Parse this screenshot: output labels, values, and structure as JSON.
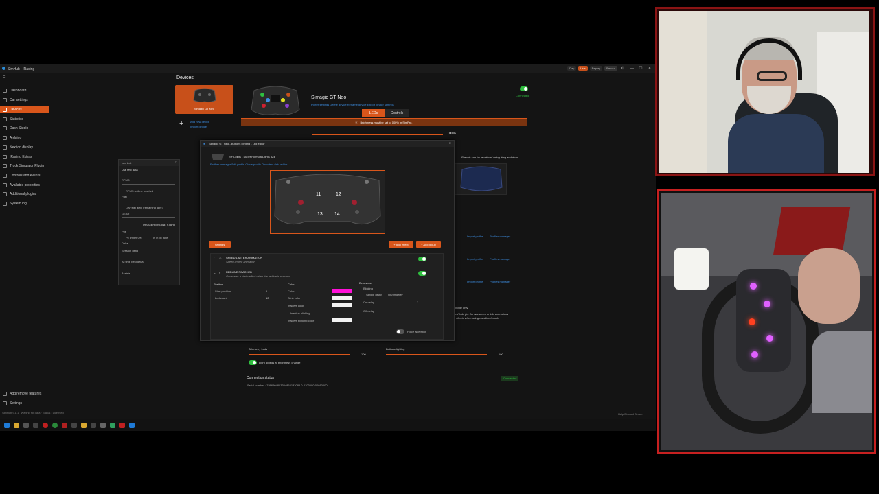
{
  "app": {
    "title": "SimHub - IRacing",
    "top_chips": {
      "day": "Day",
      "live": "Live",
      "replay": "Replay",
      "record": "Record"
    },
    "window_controls": {
      "settings": "⚙",
      "minimize": "—",
      "maximize": "☐",
      "close": "✕"
    }
  },
  "sidebar": {
    "items": [
      {
        "label": "Dashboard"
      },
      {
        "label": "Car settings"
      },
      {
        "label": "Devices",
        "active": true
      },
      {
        "label": "Statistics"
      },
      {
        "label": "Dash Studio"
      },
      {
        "label": "Arduino"
      },
      {
        "label": "Nextion display"
      },
      {
        "label": "IRacing Extras"
      },
      {
        "label": "Truck Simulator Plugin"
      },
      {
        "label": "Controls and events"
      },
      {
        "label": "Available properties"
      },
      {
        "label": "Additional plugins"
      },
      {
        "label": "System log"
      }
    ],
    "bottom": [
      {
        "label": "Add/remove features"
      },
      {
        "label": "Settings"
      }
    ],
    "version": "SimHub 9.1.1",
    "status": "Waiting for data · Status : Licensed"
  },
  "devices": {
    "heading": "Devices",
    "selected_device": "Simagic GT Neo",
    "add_new": "Add new device",
    "import": "Import device",
    "device_name": "Simagic GT Neo",
    "device_links": "Power settings  Delete device  Rename device  Export device settings",
    "connected_label": "Connected",
    "tabs": [
      "LEDs",
      "Controls"
    ],
    "brightness_warning": "Brightness must be set to 100% in SimPro.",
    "brightness_value": "100%",
    "presets_note": "Presets can be reordered using drag and drop",
    "import_profile": "Import profile",
    "profiles_manager": "Profiles manager",
    "profile_only": "profile only",
    "advanced_note": "led leds (ie : for advanced or idle animations",
    "combined_note": "effects when using combined mode",
    "telemetry_leds": "Telemetry Leds",
    "telemetry_value": "100",
    "buttons_lighting": "Buttons lighting",
    "buttons_value": "100",
    "light_all": "Light all leds at brightness change",
    "connection_status": "Connection status",
    "connected_badge": "Connected",
    "serial": "Serial number : 7866904813304854133085 0-0103000-00010000",
    "footer_right": "Help  Discord Server"
  },
  "editor": {
    "title": "Simagic GT Neo - Buttons lighting - Led editor",
    "profile": "SF Lights - Super Formula Lights 324",
    "profile_links": "Profiles manager  Edit profile  Clone profile  Open test data editor",
    "button_numbers": [
      "11",
      "12",
      "13",
      "14"
    ],
    "settings_btn": "Settings",
    "add_effect": "+ Add effect",
    "add_group": "+ Add group",
    "effect1_title": "SPEED LIMITER ANIMATION",
    "effect1_sub": "Speed limited animation",
    "effect2_title": "REDLINE REACHED",
    "effect2_sub": "Generates a static effect when the redline is reached",
    "position": "Position",
    "start_position": "Start position",
    "start_value": "1",
    "led_count": "Led count",
    "count_value": "10",
    "color_heading": "Color",
    "color": "Color",
    "blink_color": "Blink color",
    "inactive_color": "Inactive color",
    "inactive_blinking": "Inactive blinking",
    "inactive_blinking_color": "Inactive blinking color",
    "behaviour": "Behaviour",
    "blinking": "Blinking",
    "simple_delay": "Simple delay",
    "onoff_delay": "On/off delay",
    "on_delay": "On delay",
    "off_delay": "Off delay",
    "on_value": "1",
    "force_activation": "Force activation",
    "colors": {
      "primary": "#ff10d8",
      "white": "#f2f2f2"
    }
  },
  "ledtest": {
    "title": "Led test",
    "use_test_data": "Use test data",
    "rpms": "RPMS",
    "redline": "RPMS redline reached",
    "fuel": "Fuel",
    "low_fuel": "Low fuel alert (remaining laps)",
    "gear": "GEAR",
    "trigger": "TRIGGER ENGINE START",
    "pits": "Pits",
    "pit_limiter": "Pit limiter ON",
    "in_pit_lane": "Is in pit lane",
    "delta": "Delta",
    "session_delta": "Session delta",
    "all_time": "All time best delta",
    "assists": "Assists"
  },
  "colors": {
    "accent": "#d9561b",
    "link": "#3d8de0",
    "success": "#2fbf3f",
    "cam_frame": "#c62020"
  }
}
